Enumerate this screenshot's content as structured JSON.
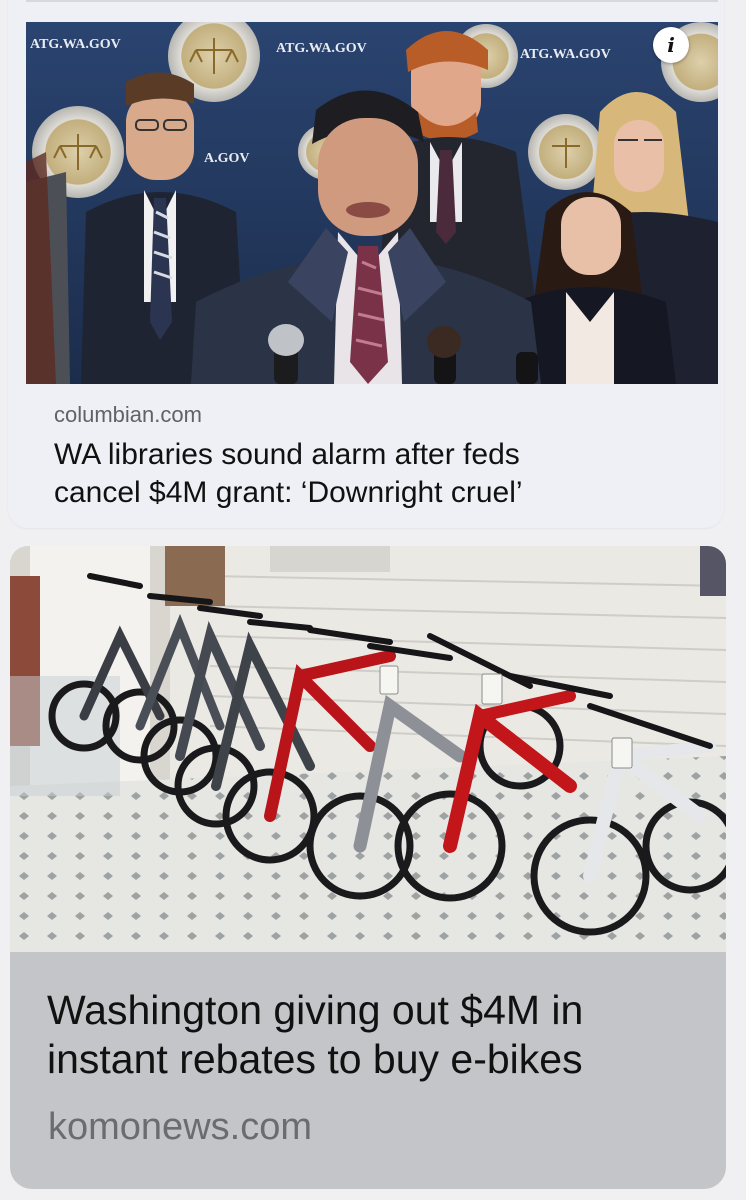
{
  "feed": {
    "items": [
      {
        "source": "columbian.com",
        "headline_lines": [
          "WA libraries sound alarm after feds",
          "cancel $4M grant: ‘Downright cruel’"
        ],
        "info_icon": "info-icon",
        "photo_backdrop_text": "ATG.WA.GOV"
      },
      {
        "headline_lines": [
          "Washington giving out $4M in",
          "instant rebates to buy e-bikes"
        ],
        "source": "komonews.com"
      }
    ]
  },
  "colors": {
    "background": "#f0f0f2",
    "card1_bg": "#eef0f5",
    "card2_bg": "#c4c5c8",
    "source_text": "#5f6268",
    "headline_text": "#111111",
    "backdrop_navy": "#243a60",
    "bike_red": "#c2161b"
  }
}
